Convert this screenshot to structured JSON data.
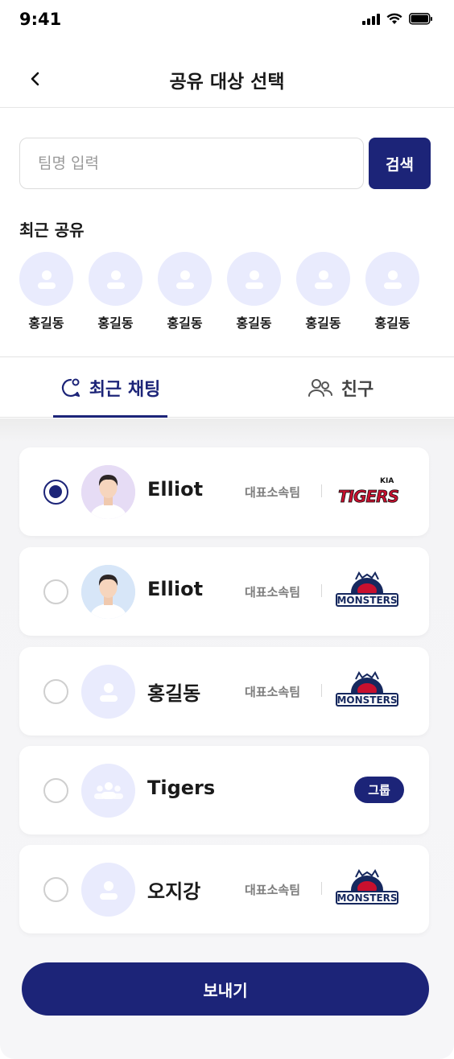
{
  "status_bar": {
    "time": "9:41"
  },
  "header": {
    "title": "공유 대상 선택"
  },
  "search": {
    "placeholder": "팀명 입력",
    "button_label": "검색"
  },
  "recent": {
    "title": "최근 공유",
    "items": [
      {
        "name": "홍길동"
      },
      {
        "name": "홍길동"
      },
      {
        "name": "홍길동"
      },
      {
        "name": "홍길동"
      },
      {
        "name": "홍길동"
      },
      {
        "name": "홍길동"
      }
    ]
  },
  "tabs": [
    {
      "label": "최근 채팅",
      "icon": "chat-icon",
      "active": true
    },
    {
      "label": "친구",
      "icon": "friends-icon",
      "active": false
    }
  ],
  "list": [
    {
      "name": "Elliot",
      "team_label": "대표소속팀",
      "team": "TIGERS",
      "avatar": "photo",
      "selected": true
    },
    {
      "name": "Elliot",
      "team_label": "대표소속팀",
      "team": "MONSTERS",
      "avatar": "photo",
      "selected": false
    },
    {
      "name": "홍길동",
      "team_label": "대표소속팀",
      "team": "MONSTERS",
      "avatar": "person-icon",
      "selected": false
    },
    {
      "name": "Tigers",
      "badge": "그룹",
      "avatar": "group-icon",
      "selected": false
    },
    {
      "name": "오지강",
      "team_label": "대표소속팀",
      "team": "MONSTERS",
      "avatar": "person-icon",
      "selected": false
    }
  ],
  "send_button": {
    "label": "보내기"
  },
  "colors": {
    "primary": "#1c2478",
    "avatar_bg": "#e9ebfd",
    "avatar_icon": "#ffffff",
    "tigers_red": "#c8102e"
  }
}
